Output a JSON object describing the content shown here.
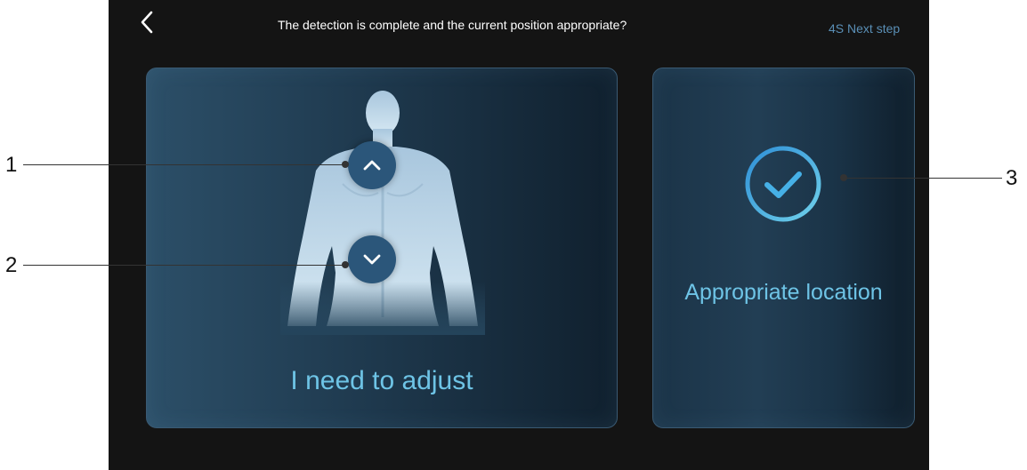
{
  "header": {
    "title": "The detection is complete and the current position appropriate?",
    "next_label": "4S Next step"
  },
  "adjust_card": {
    "label": "I need to adjust"
  },
  "ok_card": {
    "label": "Appropriate location"
  },
  "callouts": [
    "1",
    "2",
    "3"
  ],
  "colors": {
    "accent": "#6ec4e6",
    "next": "#5a8fb6",
    "button": "#2b567a",
    "background": "#141414"
  },
  "icons": {
    "back": "chevron-left-icon",
    "up": "chevron-up-icon",
    "down": "chevron-down-icon",
    "check": "check-circle-icon"
  }
}
